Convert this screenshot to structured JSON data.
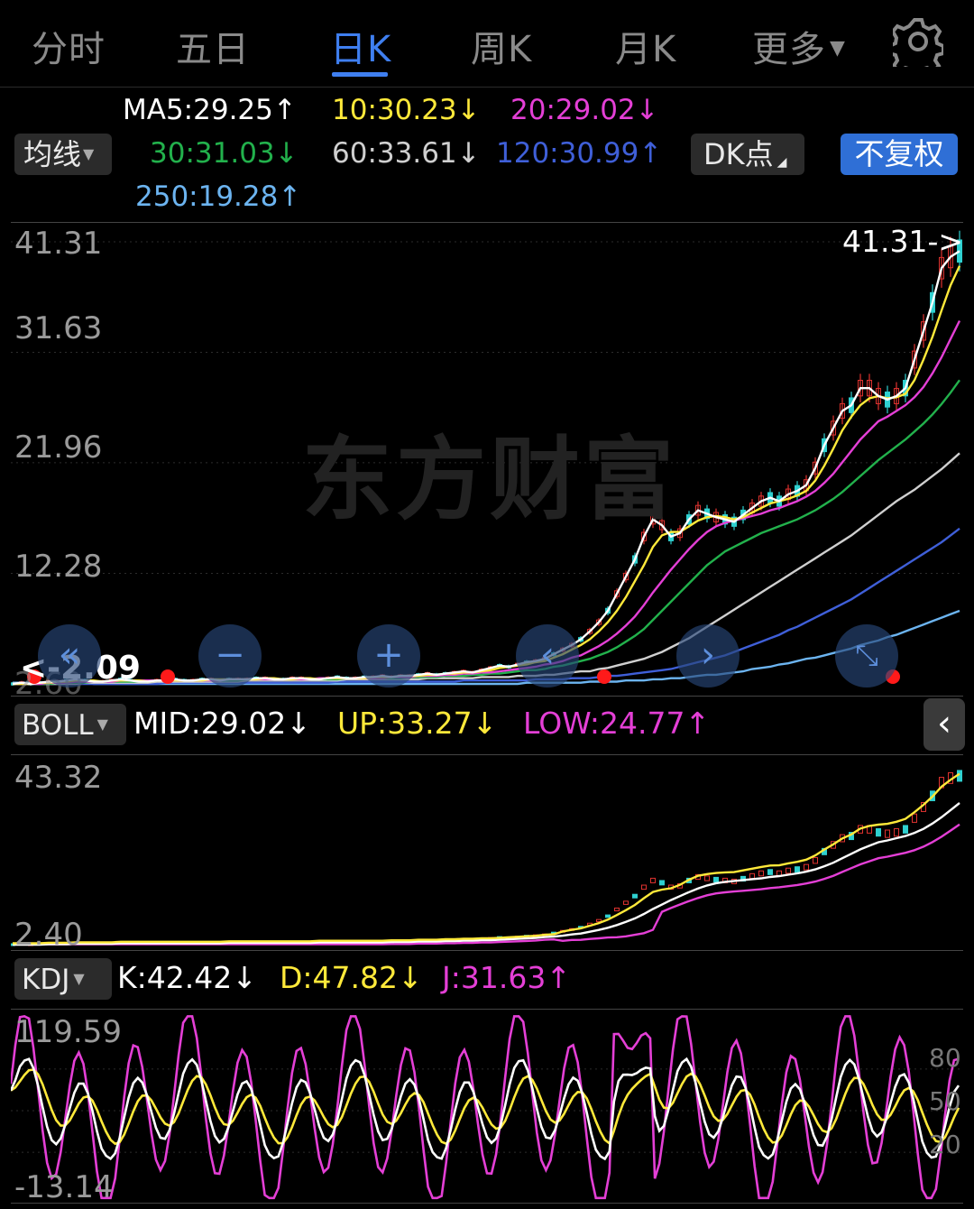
{
  "tabs": [
    {
      "label": "分时",
      "active": false
    },
    {
      "label": "五日",
      "active": false
    },
    {
      "label": "日K",
      "active": true
    },
    {
      "label": "周K",
      "active": false
    },
    {
      "label": "月K",
      "active": false
    },
    {
      "label": "更多",
      "active": false
    }
  ],
  "settings_icon": "gear-icon",
  "ma_legend": {
    "ma5": "MA5:29.25↑",
    "ma10": "10:30.23↓",
    "ma20": "20:29.02↓",
    "ma30": "30:31.03↓",
    "ma60": "60:33.61↓",
    "ma120": "120:30.99↑",
    "ma250": "250:19.28↑"
  },
  "buttons": {
    "ma_selector": "均线",
    "dk": "DK点",
    "adjust": "不复权"
  },
  "colors": {
    "ma5": "#ffffff",
    "ma10": "#ffe93a",
    "ma20": "#e43fd6",
    "ma30": "#22b14c",
    "ma60": "#cfcfcf",
    "ma120": "#3f5fd8",
    "ma250": "#6cb4f0",
    "up": "#e0322f",
    "down": "#2fd0d0",
    "accent": "#3f7ff0"
  },
  "watermark": "东方财富",
  "main_axis": {
    "labels": [
      "41.31",
      "31.63",
      "21.96",
      "12.28",
      "2.60"
    ]
  },
  "main_markers": {
    "max": "41.31",
    "min": "2.09"
  },
  "boll": {
    "selector": "BOLL",
    "mid": "MID:29.02↓",
    "up": "UP:33.27↓",
    "low": "LOW:24.77↑",
    "axis": [
      "43.32",
      "2.40"
    ]
  },
  "kdj": {
    "selector": "KDJ",
    "k": "K:42.42↓",
    "d": "D:47.82↓",
    "j": "J:31.63↑",
    "axis_left": [
      "119.59",
      "-13.14"
    ],
    "axis_right": [
      "80",
      "50",
      "20"
    ]
  },
  "nav_icons": [
    "double-left-icon",
    "zoom-out-icon",
    "zoom-in-icon",
    "left-icon",
    "right-icon",
    "fullscreen-icon"
  ],
  "chart_data": {
    "type": "line",
    "title": "",
    "x": [
      0,
      10,
      20,
      30,
      40,
      50,
      60,
      70,
      80,
      90,
      100,
      110,
      120,
      130,
      140,
      150,
      160,
      170,
      180,
      190,
      200,
      210,
      220,
      230,
      240,
      250,
      260,
      270,
      280,
      290,
      300,
      310,
      320,
      330,
      340,
      350,
      360,
      370,
      380,
      390,
      400,
      410,
      420,
      430,
      440,
      450,
      460,
      470,
      480,
      490,
      500,
      510,
      520,
      530,
      540,
      550,
      560,
      570,
      580,
      590,
      600,
      610,
      620,
      630,
      640,
      650,
      660,
      670,
      680,
      690,
      700,
      710,
      720,
      730,
      740,
      750,
      760,
      770,
      780,
      790,
      800,
      810,
      820,
      830,
      840,
      850,
      860,
      870,
      880,
      890,
      900,
      910,
      920,
      930,
      940,
      950,
      960,
      970,
      980,
      990,
      1000,
      1010,
      1020,
      1030,
      1040,
      1050
    ],
    "series": [
      {
        "name": "MA5",
        "values": [
          2.6,
          2.7,
          2.6,
          2.7,
          2.8,
          2.8,
          2.9,
          3.0,
          2.9,
          2.8,
          2.8,
          2.9,
          3.0,
          2.9,
          2.8,
          2.8,
          2.9,
          2.9,
          3.0,
          2.9,
          2.9,
          3.0,
          3.0,
          2.9,
          3.0,
          3.0,
          3.0,
          3.1,
          3.1,
          3.0,
          3.0,
          3.1,
          3.1,
          3.0,
          3.0,
          3.1,
          3.2,
          3.1,
          3.1,
          3.2,
          3.2,
          3.3,
          3.2,
          3.3,
          3.3,
          3.4,
          3.5,
          3.4,
          3.5,
          3.6,
          3.7,
          3.6,
          3.8,
          4.0,
          4.2,
          4.1,
          4.3,
          4.5,
          4.6,
          4.8,
          5.2,
          5.6,
          6.0,
          6.5,
          7.2,
          8.0,
          9.0,
          10.5,
          12.0,
          13.5,
          15.5,
          17.0,
          16.5,
          15.5,
          15.8,
          17.0,
          17.8,
          17.5,
          17.2,
          17.0,
          16.8,
          17.4,
          18.0,
          18.6,
          18.9,
          18.6,
          19.2,
          19.5,
          20.0,
          21.5,
          23.5,
          25.0,
          26.5,
          27.0,
          28.5,
          28.5,
          27.8,
          27.5,
          27.8,
          28.5,
          31.0,
          33.5,
          36.0,
          39.0,
          40.0,
          40.5
        ]
      },
      {
        "name": "MA10",
        "values": [
          2.6,
          2.6,
          2.6,
          2.7,
          2.7,
          2.8,
          2.8,
          2.9,
          2.9,
          2.9,
          2.8,
          2.9,
          2.9,
          2.9,
          2.9,
          2.8,
          2.9,
          2.9,
          2.9,
          2.9,
          2.9,
          2.9,
          3.0,
          3.0,
          3.0,
          3.0,
          3.0,
          3.0,
          3.1,
          3.1,
          3.0,
          3.0,
          3.1,
          3.1,
          3.0,
          3.1,
          3.1,
          3.1,
          3.1,
          3.1,
          3.2,
          3.2,
          3.2,
          3.3,
          3.3,
          3.3,
          3.4,
          3.4,
          3.5,
          3.5,
          3.6,
          3.6,
          3.7,
          3.8,
          4.0,
          4.1,
          4.2,
          4.3,
          4.5,
          4.6,
          4.9,
          5.2,
          5.6,
          6.0,
          6.5,
          7.2,
          8.0,
          9.0,
          10.2,
          11.6,
          13.0,
          14.6,
          15.6,
          15.9,
          15.9,
          16.4,
          16.9,
          17.2,
          17.3,
          17.2,
          17.0,
          17.2,
          17.6,
          18.0,
          18.4,
          18.6,
          18.8,
          19.1,
          19.5,
          20.4,
          21.7,
          23.2,
          24.8,
          26.0,
          27.0,
          27.6,
          27.8,
          27.6,
          27.7,
          28.0,
          29.2,
          31.0,
          33.0,
          35.3,
          37.5,
          39.2
        ]
      },
      {
        "name": "MA20",
        "values": [
          2.6,
          2.6,
          2.6,
          2.6,
          2.7,
          2.7,
          2.7,
          2.8,
          2.8,
          2.8,
          2.8,
          2.8,
          2.9,
          2.9,
          2.9,
          2.9,
          2.9,
          2.9,
          2.9,
          2.9,
          2.9,
          2.9,
          2.9,
          2.9,
          3.0,
          3.0,
          3.0,
          3.0,
          3.0,
          3.0,
          3.0,
          3.0,
          3.0,
          3.0,
          3.1,
          3.1,
          3.1,
          3.1,
          3.1,
          3.1,
          3.1,
          3.1,
          3.2,
          3.2,
          3.2,
          3.3,
          3.3,
          3.3,
          3.4,
          3.4,
          3.5,
          3.5,
          3.6,
          3.6,
          3.7,
          3.8,
          3.9,
          4.0,
          4.1,
          4.3,
          4.4,
          4.6,
          4.9,
          5.1,
          5.5,
          5.9,
          6.4,
          7.0,
          7.7,
          8.5,
          9.5,
          10.6,
          11.6,
          12.6,
          13.5,
          14.4,
          15.2,
          15.9,
          16.4,
          16.7,
          16.9,
          17.1,
          17.3,
          17.5,
          17.8,
          18.0,
          18.3,
          18.6,
          19.0,
          19.5,
          20.2,
          21.0,
          22.0,
          23.0,
          24.0,
          24.8,
          25.6,
          26.0,
          26.5,
          27.0,
          27.7,
          28.6,
          29.8,
          31.2,
          32.8,
          34.4
        ]
      },
      {
        "name": "MA30",
        "values": [
          2.6,
          2.6,
          2.6,
          2.6,
          2.6,
          2.7,
          2.7,
          2.7,
          2.7,
          2.8,
          2.8,
          2.8,
          2.8,
          2.8,
          2.8,
          2.8,
          2.9,
          2.9,
          2.9,
          2.9,
          2.9,
          2.9,
          2.9,
          2.9,
          2.9,
          2.9,
          3.0,
          3.0,
          3.0,
          3.0,
          3.0,
          3.0,
          3.0,
          3.0,
          3.0,
          3.0,
          3.0,
          3.1,
          3.1,
          3.1,
          3.1,
          3.1,
          3.1,
          3.1,
          3.2,
          3.2,
          3.2,
          3.2,
          3.3,
          3.3,
          3.3,
          3.4,
          3.4,
          3.5,
          3.5,
          3.6,
          3.7,
          3.8,
          3.8,
          3.9,
          4.1,
          4.2,
          4.4,
          4.6,
          4.8,
          5.1,
          5.4,
          5.8,
          6.3,
          6.8,
          7.4,
          8.2,
          9.0,
          9.8,
          10.6,
          11.4,
          12.2,
          13.0,
          13.6,
          14.2,
          14.6,
          15.0,
          15.4,
          15.8,
          16.1,
          16.4,
          16.7,
          17.0,
          17.4,
          17.8,
          18.3,
          18.8,
          19.4,
          20.1,
          20.8,
          21.5,
          22.2,
          22.8,
          23.4,
          24.0,
          24.7,
          25.4,
          26.2,
          27.1,
          28.1,
          29.2
        ]
      },
      {
        "name": "MA60",
        "values": [
          2.6,
          2.6,
          2.6,
          2.6,
          2.6,
          2.6,
          2.6,
          2.6,
          2.7,
          2.7,
          2.7,
          2.7,
          2.7,
          2.7,
          2.7,
          2.7,
          2.8,
          2.8,
          2.8,
          2.8,
          2.8,
          2.8,
          2.8,
          2.8,
          2.8,
          2.8,
          2.9,
          2.9,
          2.9,
          2.9,
          2.9,
          2.9,
          2.9,
          2.9,
          2.9,
          2.9,
          2.9,
          3.0,
          3.0,
          3.0,
          3.0,
          3.0,
          3.0,
          3.0,
          3.0,
          3.0,
          3.1,
          3.1,
          3.1,
          3.1,
          3.1,
          3.1,
          3.2,
          3.2,
          3.2,
          3.2,
          3.3,
          3.3,
          3.3,
          3.4,
          3.4,
          3.5,
          3.6,
          3.7,
          3.7,
          3.9,
          4.0,
          4.2,
          4.4,
          4.6,
          4.8,
          5.1,
          5.4,
          5.8,
          6.2,
          6.6,
          7.1,
          7.6,
          8.1,
          8.6,
          9.1,
          9.6,
          10.1,
          10.6,
          11.1,
          11.6,
          12.1,
          12.6,
          13.1,
          13.6,
          14.1,
          14.6,
          15.1,
          15.6,
          16.2,
          16.8,
          17.4,
          18.0,
          18.6,
          19.1,
          19.6,
          20.2,
          20.8,
          21.4,
          22.1,
          22.8
        ]
      },
      {
        "name": "MA120",
        "values": [
          2.6,
          2.6,
          2.6,
          2.6,
          2.6,
          2.6,
          2.6,
          2.6,
          2.6,
          2.6,
          2.6,
          2.6,
          2.6,
          2.6,
          2.6,
          2.6,
          2.6,
          2.7,
          2.7,
          2.7,
          2.7,
          2.7,
          2.7,
          2.7,
          2.7,
          2.7,
          2.7,
          2.7,
          2.7,
          2.7,
          2.7,
          2.7,
          2.7,
          2.7,
          2.7,
          2.7,
          2.8,
          2.8,
          2.8,
          2.8,
          2.8,
          2.8,
          2.8,
          2.8,
          2.8,
          2.8,
          2.8,
          2.8,
          2.8,
          2.8,
          2.9,
          2.9,
          2.9,
          2.9,
          2.9,
          2.9,
          2.9,
          2.9,
          3.0,
          3.0,
          3.0,
          3.0,
          3.1,
          3.1,
          3.1,
          3.2,
          3.3,
          3.3,
          3.4,
          3.5,
          3.6,
          3.7,
          3.8,
          3.9,
          4.1,
          4.3,
          4.5,
          4.7,
          4.9,
          5.1,
          5.4,
          5.7,
          6.0,
          6.3,
          6.6,
          6.9,
          7.3,
          7.6,
          8.0,
          8.4,
          8.8,
          9.2,
          9.6,
          10.0,
          10.5,
          11.0,
          11.5,
          12.0,
          12.5,
          13.0,
          13.5,
          14.0,
          14.5,
          15.0,
          15.6,
          16.2
        ]
      },
      {
        "name": "MA250",
        "values": [
          2.7,
          2.7,
          2.7,
          2.7,
          2.7,
          2.7,
          2.7,
          2.7,
          2.7,
          2.6,
          2.6,
          2.6,
          2.6,
          2.6,
          2.6,
          2.6,
          2.6,
          2.6,
          2.6,
          2.6,
          2.6,
          2.6,
          2.6,
          2.6,
          2.6,
          2.6,
          2.6,
          2.6,
          2.6,
          2.6,
          2.6,
          2.6,
          2.6,
          2.6,
          2.6,
          2.6,
          2.6,
          2.6,
          2.6,
          2.6,
          2.6,
          2.6,
          2.6,
          2.6,
          2.6,
          2.6,
          2.6,
          2.6,
          2.6,
          2.6,
          2.6,
          2.6,
          2.6,
          2.6,
          2.6,
          2.6,
          2.6,
          2.7,
          2.7,
          2.7,
          2.7,
          2.7,
          2.7,
          2.7,
          2.8,
          2.8,
          2.8,
          2.8,
          2.9,
          2.9,
          2.9,
          3.0,
          3.0,
          3.1,
          3.1,
          3.2,
          3.3,
          3.4,
          3.4,
          3.5,
          3.6,
          3.7,
          3.9,
          4.0,
          4.1,
          4.3,
          4.4,
          4.6,
          4.8,
          4.9,
          5.1,
          5.3,
          5.5,
          5.7,
          6.0,
          6.2,
          6.4,
          6.7,
          6.9,
          7.2,
          7.5,
          7.8,
          8.1,
          8.4,
          8.7,
          9.0
        ]
      }
    ],
    "ylim": [
      2.6,
      41.31
    ],
    "boll": {
      "ylim": [
        2.4,
        43.32
      ]
    },
    "kdj": {
      "ylim": [
        -13.14,
        119.59
      ]
    }
  }
}
